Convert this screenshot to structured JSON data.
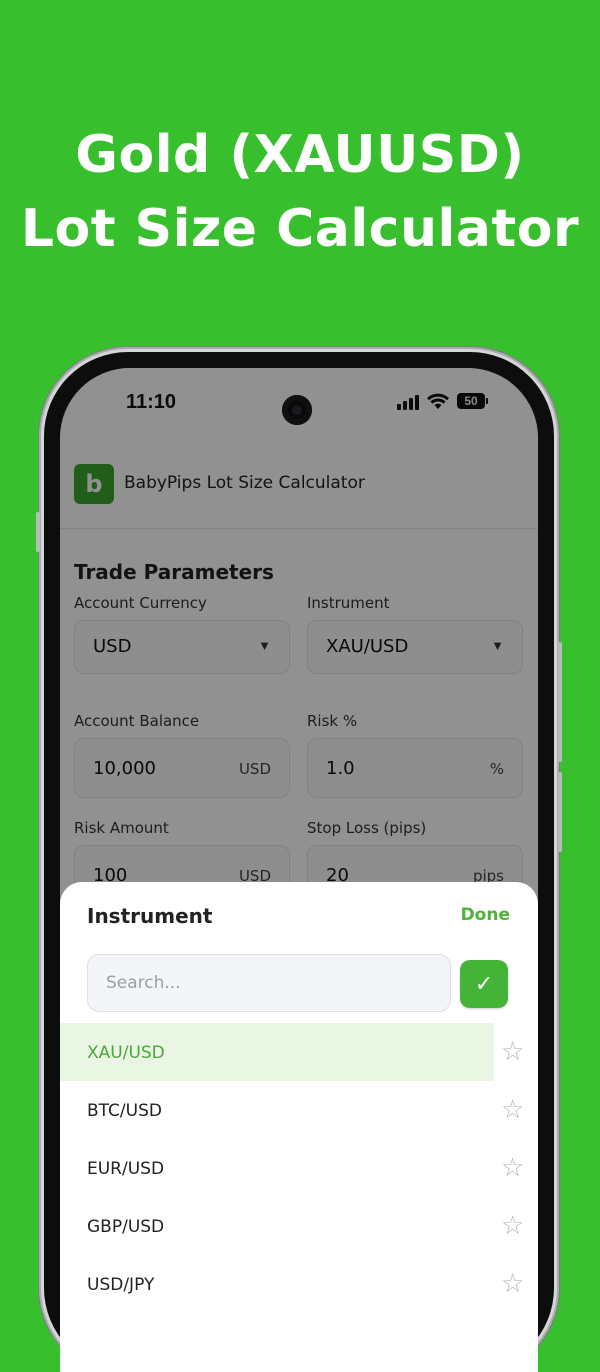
{
  "headline": {
    "line1": "Gold (XAUUSD)",
    "line2": "Lot Size Calculator"
  },
  "status": {
    "time": "11:10",
    "battery": "50"
  },
  "app": {
    "logo_letter": "b",
    "title": "BabyPips Lot Size Calculator",
    "accent": "#3aa62e"
  },
  "form": {
    "section_title": "Trade Parameters",
    "account_currency": {
      "label": "Account Currency",
      "value": "USD"
    },
    "instrument": {
      "label": "Instrument",
      "value": "XAU/USD"
    },
    "account_balance": {
      "label": "Account Balance",
      "value": "10,000",
      "unit": "USD"
    },
    "risk_percent": {
      "label": "Risk %",
      "value": "1.0",
      "unit": "%"
    },
    "risk_amount": {
      "label": "Risk Amount",
      "value": "100",
      "unit": "USD"
    },
    "stop_loss": {
      "label": "Stop Loss (pips)",
      "value": "20",
      "unit": "pips"
    }
  },
  "sheet": {
    "title": "Instrument",
    "done_label": "Done",
    "search_placeholder": "Search...",
    "items": [
      {
        "code": "XAU/USD",
        "selected": true
      },
      {
        "code": "BTC/USD",
        "selected": false
      },
      {
        "code": "EUR/USD",
        "selected": false
      },
      {
        "code": "GBP/USD",
        "selected": false
      },
      {
        "code": "USD/JPY",
        "selected": false
      }
    ]
  },
  "colors": {
    "background": "#38bf2e",
    "selected_row": "#e9f6e3",
    "done": "#4db33a"
  }
}
